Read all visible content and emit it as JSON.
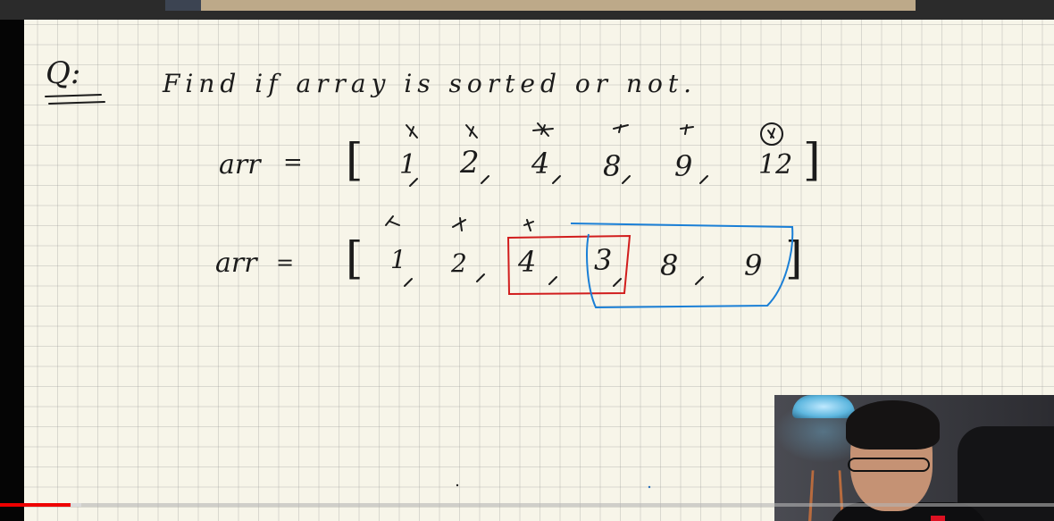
{
  "video": {
    "progress_played_fraction": 0.067,
    "progress_buffered_fraction": 0.077,
    "accent_color": "#ee0000"
  },
  "whiteboard": {
    "question_label": "Q:",
    "question_text": "Find if array is sorted or not.",
    "example1": {
      "var_label": "arr",
      "equals": "=",
      "open_bracket": "[",
      "close_bracket": "]",
      "elements": [
        "1",
        "2",
        "4",
        "8",
        "9",
        "12"
      ]
    },
    "example2": {
      "var_label": "arr",
      "equals": "=",
      "open_bracket": "[",
      "close_bracket": "]",
      "elements": [
        "1",
        "2",
        "4",
        "3",
        "8",
        "9"
      ]
    },
    "highlight_colors": {
      "red_box": "#d11d1d",
      "blue_box": "#1a7fd6"
    }
  },
  "webcam": {
    "icon": "presenter-video"
  }
}
